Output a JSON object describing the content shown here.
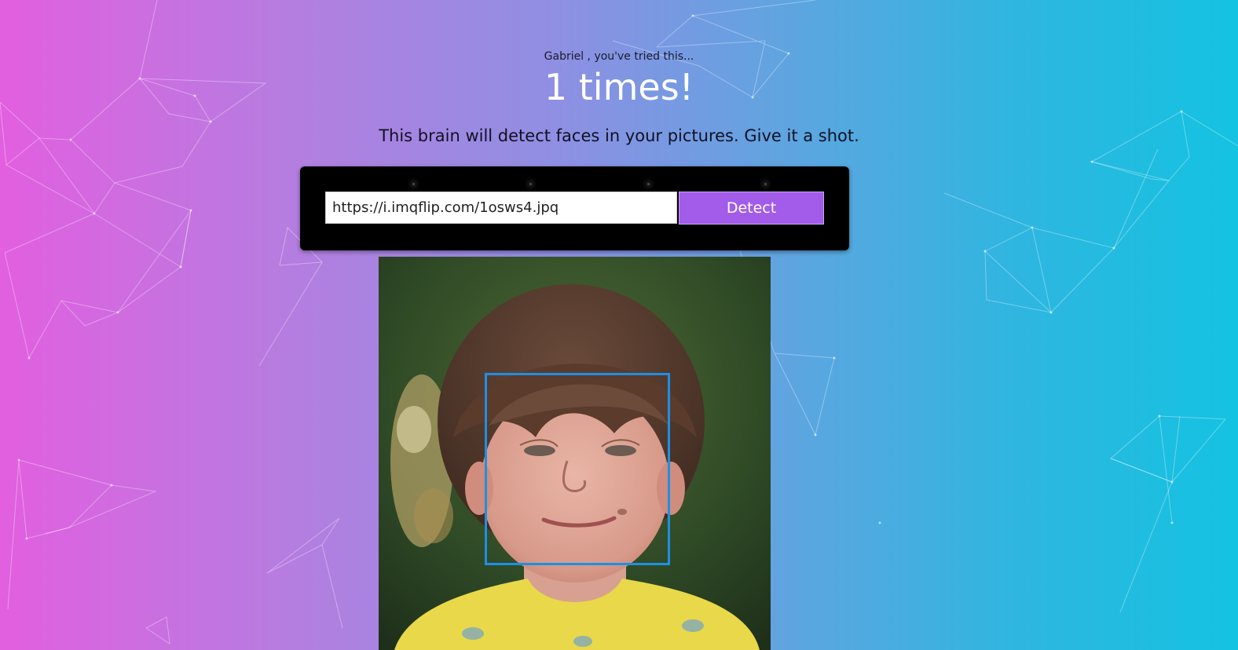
{
  "header": {
    "greeting": "Gabriel , you've tried this...",
    "count": "1 times!",
    "tagline": "This brain will detect faces in your pictures. Give it a shot."
  },
  "form": {
    "url_value": "https://i.imqflip.com/1osws4.jpq",
    "detect_label": "Detect"
  },
  "result": {
    "image_subject": "child school portrait photo",
    "face_box_color": "#1e8fe6"
  },
  "colors": {
    "gradient_left": "#e25fe0",
    "gradient_right": "#14c2e1",
    "button": "#a35bea",
    "card": "#000000"
  },
  "background": {
    "pattern": "particle-network"
  }
}
